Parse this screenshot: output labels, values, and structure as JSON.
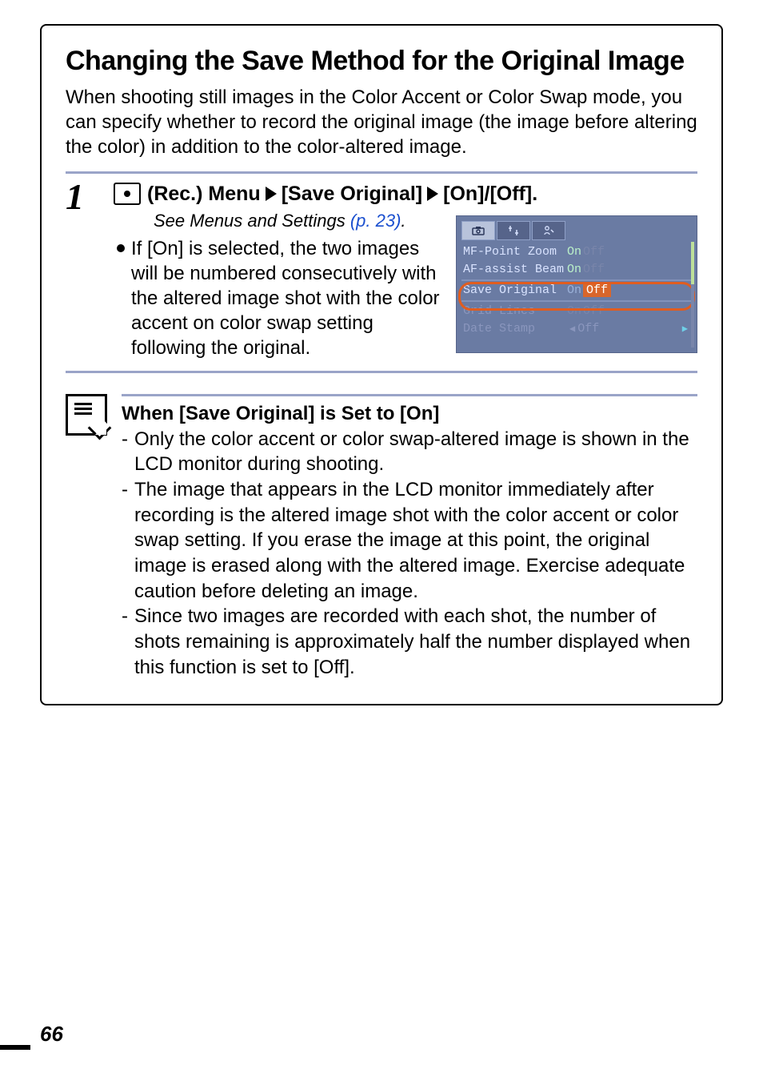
{
  "title": "Changing the Save Method for the Original Image",
  "intro": "When shooting still images in the Color Accent or Color Swap mode, you can specify whether to record the original image (the image before altering the color) in addition to the color-altered image.",
  "step": {
    "number": "1",
    "heading": {
      "part1": "(Rec.) Menu",
      "part2": "[Save Original]",
      "part3": "[On]/[Off]."
    },
    "see_prefix": "See Menus and Settings ",
    "see_ref": "(p. 23)",
    "see_suffix": ".",
    "bullet": "If [On] is selected, the two images will be numbered consecutively with the altered image shot with the color accent on color swap setting following the original."
  },
  "lcd": {
    "rows": [
      {
        "label": "MF-Point Zoom",
        "on": "On",
        "off": "Off",
        "sel": "on"
      },
      {
        "label": "AF-assist Beam",
        "on": "On",
        "off": "Off",
        "sel": "on"
      },
      {
        "label": "Save Original",
        "on": "On",
        "off": "Off",
        "sel": "off",
        "highlight": true
      },
      {
        "label": "Grid Lines",
        "on": "On",
        "off": "Off",
        "sel": "on",
        "dim": true
      },
      {
        "label": "Date Stamp",
        "value": "Off",
        "arrows": true,
        "dim": true
      }
    ]
  },
  "note": {
    "title": "When [Save Original] is Set to [On]",
    "items": [
      "Only the color accent or color swap-altered image is shown in the LCD monitor during shooting.",
      "The image that appears in the LCD monitor immediately after recording is the altered image shot with the color accent or color swap setting. If you erase the image at this point, the original image is erased along with the altered image. Exercise adequate caution before deleting an image.",
      "Since two images are recorded with each shot, the number of shots remaining is approximately half the number displayed when this function is set to [Off]."
    ]
  },
  "page_number": "66"
}
